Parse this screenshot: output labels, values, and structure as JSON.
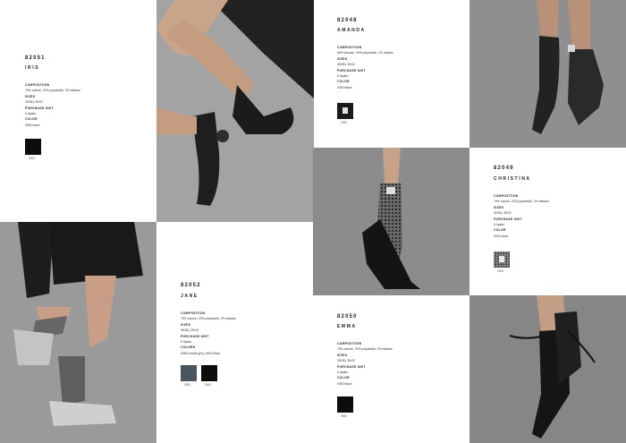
{
  "products": {
    "iris": {
      "code": "82051",
      "name": "IRIS",
      "composition_label": "COMPOSITION",
      "composition": "75% cotone, 23% polyamide, 2% elastan",
      "sizes_label": "SIZES",
      "sizes": "35/38 | 39/42",
      "unit_label": "PURCHASE UNIT",
      "unit": "6 hpairs",
      "color_label": "COLOR",
      "color": "0000 black",
      "swatches": [
        {
          "code": "0000",
          "color": "#0d0d0d"
        }
      ]
    },
    "amanda": {
      "code": "82048",
      "name": "AMANDA",
      "composition_label": "COMPOSITION",
      "composition": "68% viscose, 30% polyamide, 2% elastan",
      "sizes_label": "SIZES",
      "sizes": "35/38 | 39/42",
      "unit_label": "PURCHASE UNIT",
      "unit": "6 hpairs",
      "color_label": "COLOR",
      "color": "0000 black",
      "swatches": [
        {
          "code": "0000",
          "color": "#1a1a1a"
        }
      ]
    },
    "christina": {
      "code": "82049",
      "name": "CHRISTINA",
      "composition_label": "COMPOSITION",
      "composition": "75% cotone, 23% polyamide, 2% elastan",
      "sizes_label": "SIZES",
      "sizes": "35/38 | 39/42",
      "unit_label": "PURCHASE UNIT",
      "unit": "6 hpairs",
      "color_label": "COLOR",
      "color": "0000 black",
      "swatches": [
        {
          "code": "0000",
          "color": "#3a3a3a"
        }
      ]
    },
    "jane": {
      "code": "82052",
      "name": "JANE",
      "composition_label": "COMPOSITION",
      "composition": "75% cotone, 23% polyamide, 2% elastan",
      "sizes_label": "SIZES",
      "sizes": "35/38 | 39/42",
      "unit_label": "PURCHASE UNIT",
      "unit": "6 hpairs",
      "color_label": "COLORS",
      "color": "0550 middle grey, 0000 black",
      "swatches": [
        {
          "code": "0550",
          "color": "#4b5560"
        },
        {
          "code": "0000",
          "color": "#0d0d0d"
        }
      ]
    },
    "emma": {
      "code": "82050",
      "name": "EMMA",
      "composition_label": "COMPOSITION",
      "composition": "75% cotone, 23% polyamide, 2% elastan",
      "sizes_label": "SIZES",
      "sizes": "35/38 | 39/42",
      "unit_label": "PURCHASE UNIT",
      "unit": "6 hpairs",
      "color_label": "COLOR",
      "color": "0000 black",
      "swatches": [
        {
          "code": "0000",
          "color": "#0d0d0d"
        }
      ]
    }
  }
}
